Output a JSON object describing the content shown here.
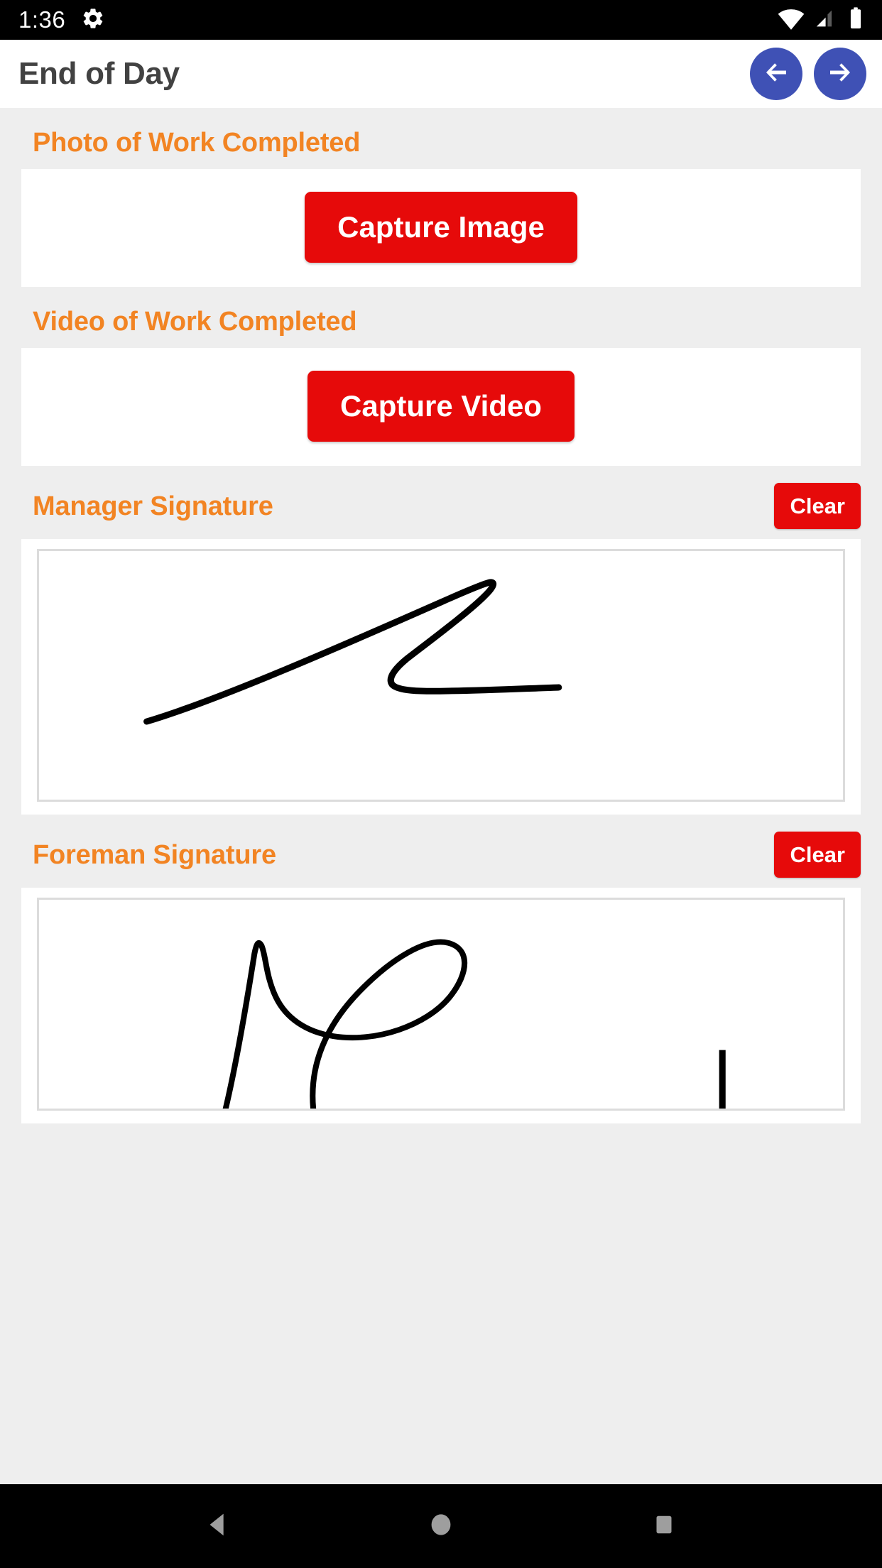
{
  "status_bar": {
    "time": "1:36",
    "icons": [
      "gear-icon",
      "wifi-icon",
      "cellular-signal-icon",
      "battery-icon"
    ]
  },
  "app_bar": {
    "title": "End of Day",
    "back_icon": "arrow-left-icon",
    "forward_icon": "arrow-right-icon",
    "nav_button_color": "#3f51b5"
  },
  "theme": {
    "background": "#eeeeee",
    "card": "#ffffff",
    "heading": "#f28423",
    "danger": "#e60a0a",
    "title_text": "#424242"
  },
  "sections": [
    {
      "key": "photo",
      "title": "Photo of Work Completed",
      "button_label": "Capture Image"
    },
    {
      "key": "video",
      "title": "Video of Work Completed",
      "button_label": "Capture Video"
    },
    {
      "key": "manager_signature",
      "title": "Manager Signature",
      "clear_label": "Clear"
    },
    {
      "key": "foreman_signature",
      "title": "Foreman Signature",
      "clear_label": "Clear"
    }
  ],
  "nav_bar": {
    "back_label": "back-triangle-icon",
    "home_label": "home-circle-icon",
    "recents_label": "recents-square-icon"
  }
}
